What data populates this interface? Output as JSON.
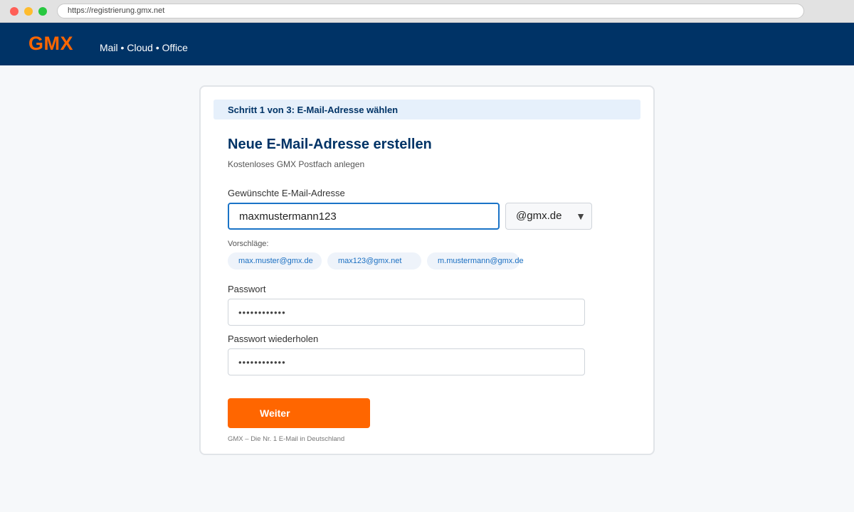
{
  "browser": {
    "url": "https://registrierung.gmx.net"
  },
  "header": {
    "logo": "GMX",
    "tagline": "Mail • Cloud • Office"
  },
  "form": {
    "step": "Schritt 1 von 3: E-Mail-Adresse wählen",
    "title": "Neue E-Mail-Adresse erstellen",
    "subtitle": "Kostenloses GMX Postfach anlegen",
    "email_label": "Gewünschte E-Mail-Adresse",
    "email_value": "maxmustermann123",
    "domain_selected": "@gmx.de",
    "suggestions_label": "Vorschläge:",
    "suggestions": [
      "max.muster@gmx.de",
      "max123@gmx.net",
      "m.mustermann@gmx.de"
    ],
    "password_label": "Passwort",
    "password_value": "••••••••••••",
    "password_repeat_label": "Passwort wiederholen",
    "password_repeat_value": "••••••••••••",
    "submit_label": "Weiter",
    "footer": "GMX – Die Nr. 1 E-Mail in Deutschland"
  },
  "colors": {
    "brand_navy": "#003366",
    "brand_orange": "#ff6600",
    "focus_blue": "#1a73c7"
  }
}
